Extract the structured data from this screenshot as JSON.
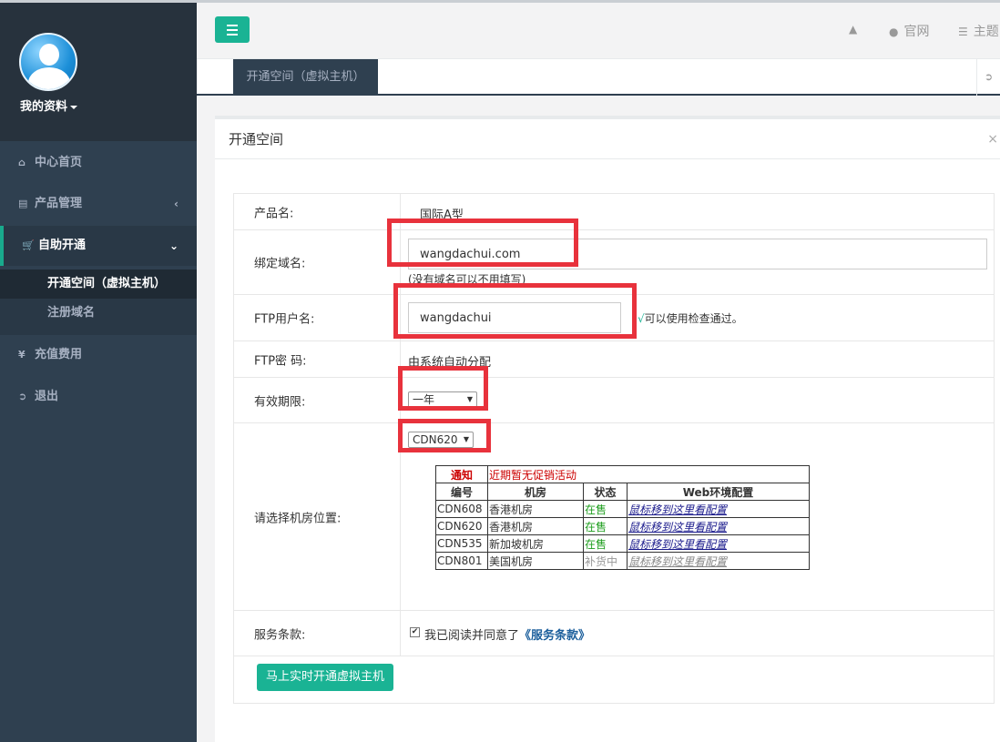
{
  "sidebar": {
    "profile_name": "我的资料",
    "items": [
      {
        "icon": "home-icon",
        "label": "中心首页"
      },
      {
        "icon": "server-icon",
        "label": "产品管理"
      },
      {
        "icon": "cart-icon",
        "label": "自助开通"
      },
      {
        "icon": "yen-icon",
        "label": "充值费用"
      },
      {
        "icon": "signout-icon",
        "label": "退出"
      }
    ],
    "subitems": [
      {
        "label": "开通空间（虚拟主机）"
      },
      {
        "label": "注册域名"
      }
    ]
  },
  "topbar": {
    "links": [
      {
        "icon": "bell-icon",
        "label": ""
      },
      {
        "icon": "globe-icon",
        "label": "官网"
      },
      {
        "icon": "list-icon",
        "label": "主题"
      }
    ]
  },
  "tabbar": {
    "active_tab": "开通空间（虚拟主机）"
  },
  "panel": {
    "title": "开通空间",
    "close": "×"
  },
  "form": {
    "product_label": "产品名:",
    "product_value": "国际A型",
    "domain_label": "绑定域名:",
    "domain_value": "wangdachui.com",
    "domain_hint": "(没有域名可以不用填写)",
    "ftp_user_label": "FTP用户名:",
    "ftp_user_value": "wangdachui",
    "ftp_check_mark": "√",
    "ftp_check_text": "可以使用检查通过。",
    "ftp_pass_label": "FTP密 码:",
    "ftp_pass_value": "由系统自动分配",
    "period_label": "有效期限:",
    "period_value": "一年",
    "room_label": "请选择机房位置:",
    "room_value": "CDN620",
    "terms_label": "服务条款:",
    "terms_text": "我已阅读并同意了",
    "terms_link": "《服务条款》",
    "submit_label": "马上实时开通虚拟主机"
  },
  "room_table": {
    "notice_label": "通知",
    "notice_text": "近期暂无促销活动",
    "headers": [
      "编号",
      "机房",
      "状态",
      "Web环境配置"
    ],
    "rows": [
      [
        "CDN608",
        "香港机房",
        "在售",
        "鼠标移到这里看配置"
      ],
      [
        "CDN620",
        "香港机房",
        "在售",
        "鼠标移到这里看配置"
      ],
      [
        "CDN535",
        "新加坡机房",
        "在售",
        "鼠标移到这里看配置"
      ],
      [
        "CDN801",
        "美国机房",
        "补货中",
        "鼠标移到这里看配置"
      ]
    ]
  },
  "colors": {
    "sidebar_bg": "#2f4050",
    "accent": "#1ab394",
    "highlight": "#e8323c",
    "in_stock": "#1e9e1e",
    "notice": "#cc0000"
  }
}
